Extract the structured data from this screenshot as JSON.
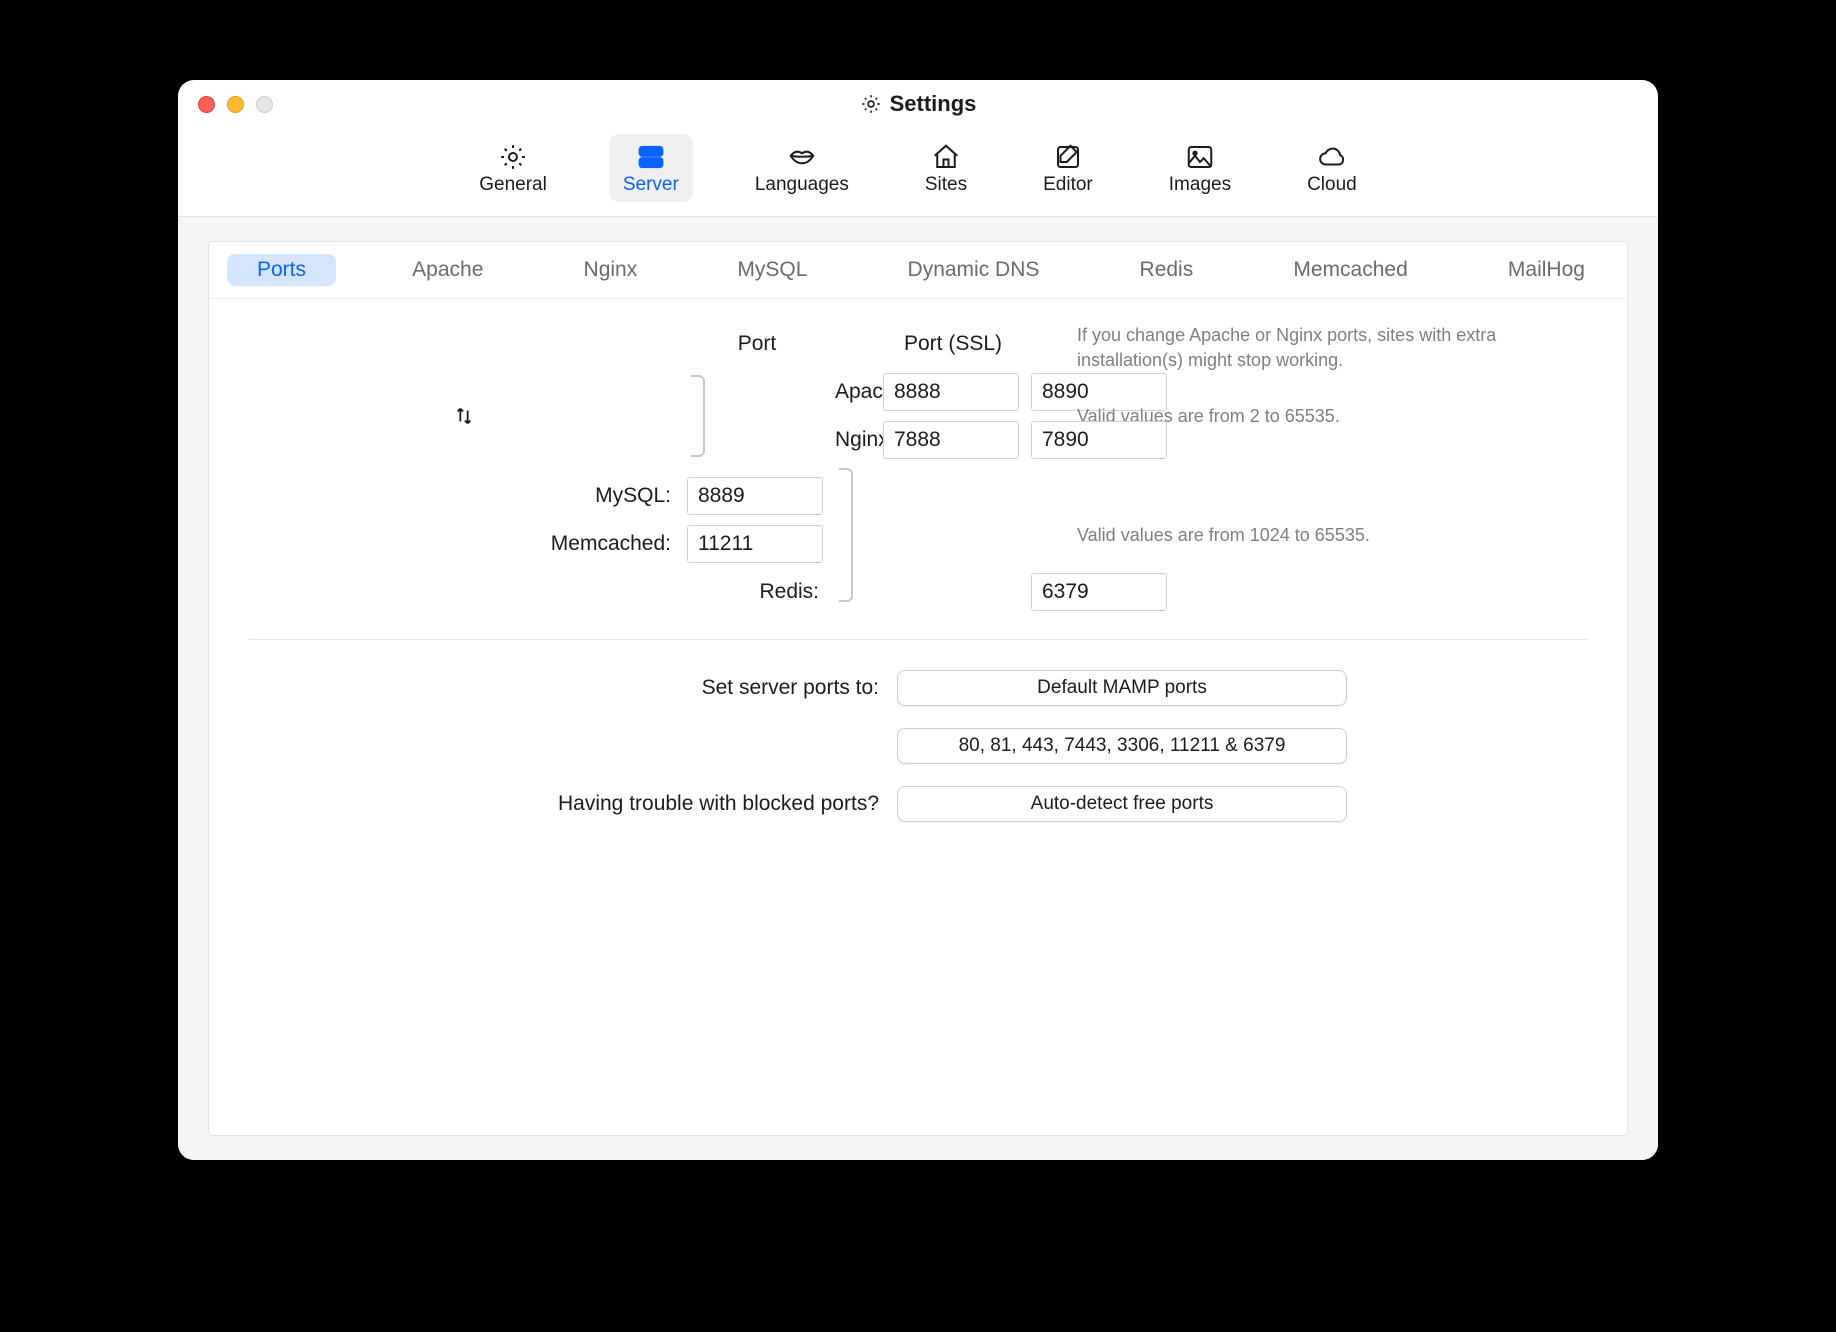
{
  "window": {
    "title": "Settings"
  },
  "toolbar": {
    "items": [
      {
        "id": "general",
        "label": "General"
      },
      {
        "id": "server",
        "label": "Server"
      },
      {
        "id": "languages",
        "label": "Languages"
      },
      {
        "id": "sites",
        "label": "Sites"
      },
      {
        "id": "editor",
        "label": "Editor"
      },
      {
        "id": "images",
        "label": "Images"
      },
      {
        "id": "cloud",
        "label": "Cloud"
      }
    ],
    "active": "server"
  },
  "subtabs": {
    "items": [
      "Ports",
      "Apache",
      "Nginx",
      "MySQL",
      "Dynamic DNS",
      "Redis",
      "Memcached",
      "MailHog"
    ],
    "active": "Ports"
  },
  "ports": {
    "headers": {
      "port": "Port",
      "ssl": "Port (SSL)"
    },
    "rows": {
      "apache": {
        "label": "Apache:",
        "port": "8888",
        "ssl": "8890"
      },
      "nginx": {
        "label": "Nginx:",
        "port": "7888",
        "ssl": "7890"
      },
      "mysql": {
        "label": "MySQL:",
        "port": "8889"
      },
      "memcached": {
        "label": "Memcached:",
        "port": "11211"
      },
      "redis": {
        "label": "Redis:",
        "port": "6379"
      }
    },
    "hints": {
      "top": "If you change Apache or Nginx ports, sites with extra installation(s) might stop working.",
      "ssl": "Valid values are from 2 to 65535.",
      "db": "Valid values are from 1024 to 65535."
    }
  },
  "actions": {
    "set_label": "Set server ports to:",
    "default_btn": "Default MAMP ports",
    "std_btn": "80, 81, 443, 7443, 3306, 11211 & 6379",
    "trouble_label": "Having trouble with blocked ports?",
    "autodetect_btn": "Auto-detect free ports"
  }
}
